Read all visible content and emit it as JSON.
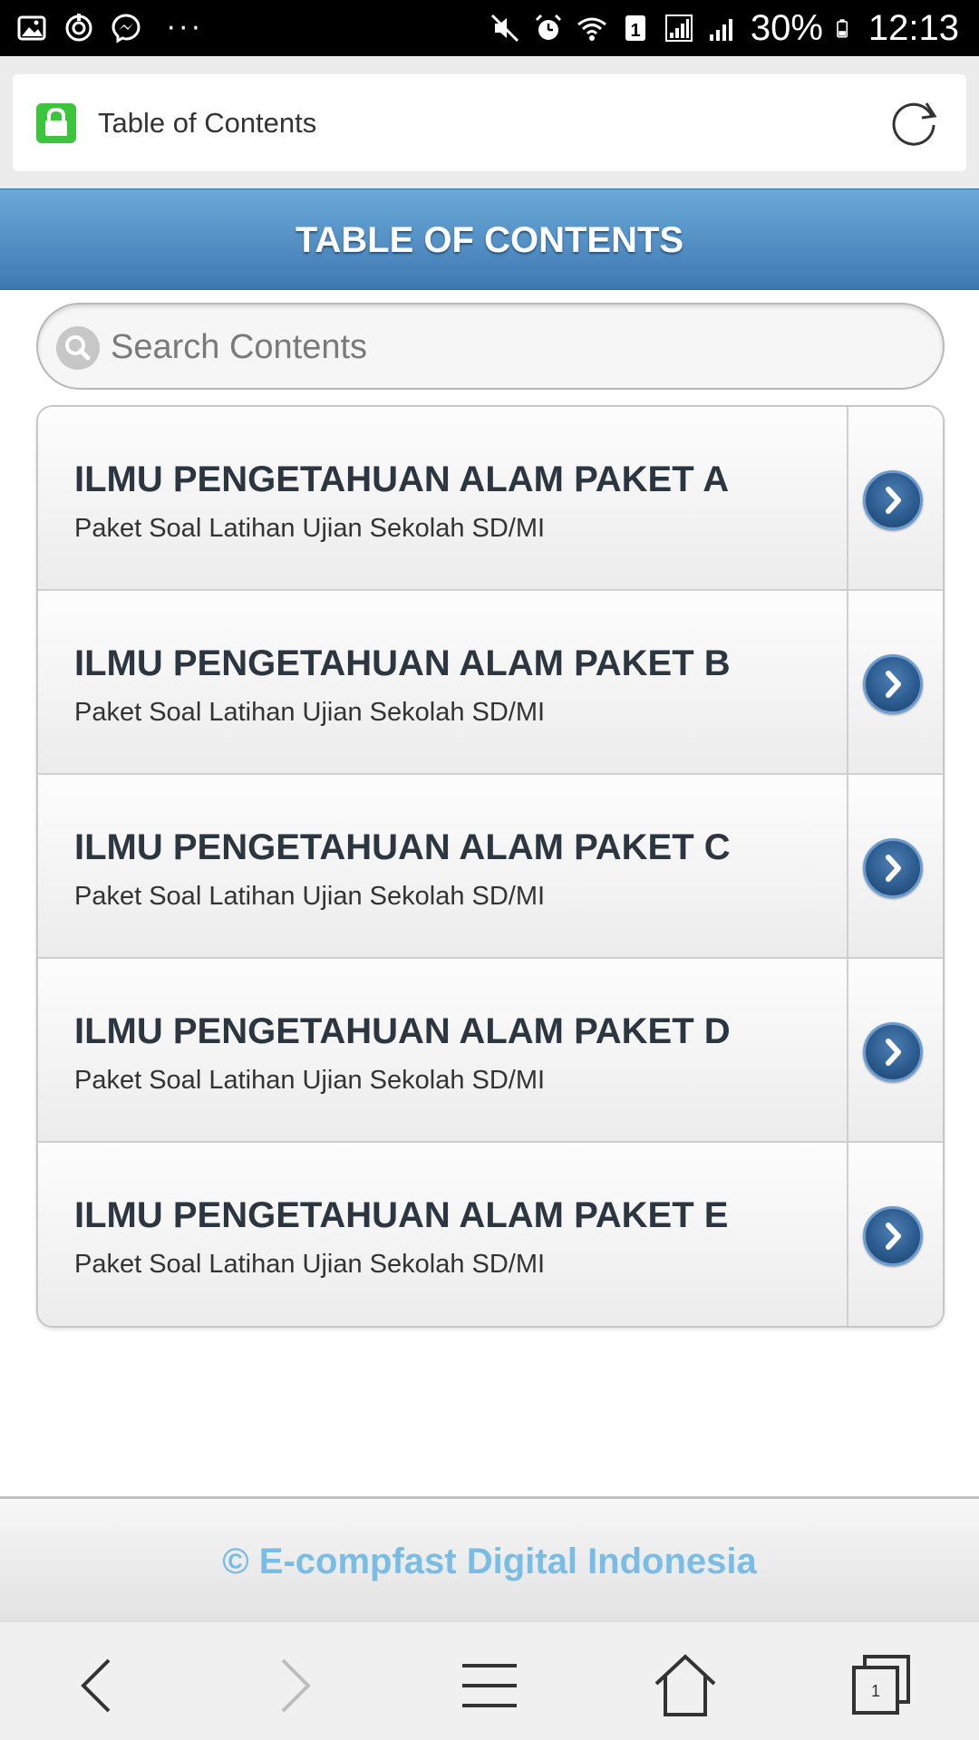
{
  "status_bar": {
    "battery_percent": "30%",
    "time": "12:13",
    "sim_badge": "1",
    "more_dots": "···"
  },
  "address_bar": {
    "title": "Table of Contents"
  },
  "header": {
    "title": "TABLE OF CONTENTS"
  },
  "search": {
    "placeholder": "Search Contents"
  },
  "items": [
    {
      "title": "ILMU PENGETAHUAN ALAM PAKET A",
      "subtitle": "Paket Soal Latihan Ujian Sekolah SD/MI"
    },
    {
      "title": "ILMU PENGETAHUAN ALAM PAKET B",
      "subtitle": "Paket Soal Latihan Ujian Sekolah SD/MI"
    },
    {
      "title": "ILMU PENGETAHUAN ALAM PAKET C",
      "subtitle": "Paket Soal Latihan Ujian Sekolah SD/MI"
    },
    {
      "title": "ILMU PENGETAHUAN ALAM PAKET D",
      "subtitle": "Paket Soal Latihan Ujian Sekolah SD/MI"
    },
    {
      "title": "ILMU PENGETAHUAN ALAM PAKET E",
      "subtitle": "Paket Soal Latihan Ujian Sekolah SD/MI"
    }
  ],
  "footer": {
    "text": "© E-compfast Digital Indonesia"
  },
  "bottom_bar": {
    "tab_count": "1"
  },
  "colors": {
    "header_top": "#6aa9d8",
    "header_bottom": "#3f79b2",
    "footer_text": "#79bde6",
    "lock_green": "#3cc43c",
    "arrow_button": "#2c5c8f"
  },
  "icons": {
    "lock": "lock-icon",
    "refresh": "refresh-icon",
    "search": "search-icon",
    "item_arrow": "chevron-right-icon",
    "back": "back-arrow-icon",
    "forward": "forward-arrow-icon",
    "menu": "menu-icon",
    "home": "home-icon",
    "tabs": "tabs-icon"
  }
}
